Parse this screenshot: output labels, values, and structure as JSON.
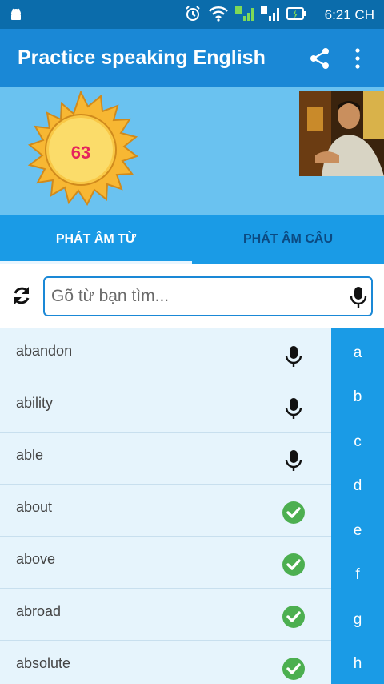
{
  "status_bar": {
    "time": "6:21 CH",
    "icons": [
      "android-icon",
      "alarm-icon",
      "wifi-icon",
      "signal-1-icon",
      "signal-2-icon",
      "battery-charging-icon"
    ]
  },
  "app_bar": {
    "title": "Practice speaking English",
    "actions": [
      "share-icon",
      "more-vert-icon"
    ]
  },
  "profile": {
    "score": "63"
  },
  "tabs": [
    {
      "label": "PHÁT ÂM TỪ",
      "active": true
    },
    {
      "label": "PHÁT ÂM CÂU",
      "active": false
    }
  ],
  "search": {
    "placeholder": "Gõ từ bạn tìm...",
    "value": ""
  },
  "words": [
    {
      "word": "abandon",
      "status": "mic-icon"
    },
    {
      "word": "ability",
      "status": "mic-icon"
    },
    {
      "word": "able",
      "status": "mic-icon"
    },
    {
      "word": "about",
      "status": "check-circle-icon"
    },
    {
      "word": "above",
      "status": "check-circle-icon"
    },
    {
      "word": "abroad",
      "status": "check-circle-icon"
    },
    {
      "word": "absolute",
      "status": "check-circle-icon"
    }
  ],
  "alphabet_index": [
    "a",
    "b",
    "c",
    "d",
    "e",
    "f",
    "g",
    "h"
  ],
  "colors": {
    "status_bar": "#0b6cab",
    "app_bar": "#1a88d6",
    "profile_bg": "#6ac2f0",
    "tabs_bg": "#1a9be6",
    "check_green": "#4caf50",
    "score_red": "#e5245c"
  }
}
